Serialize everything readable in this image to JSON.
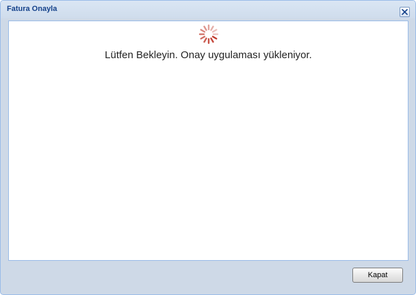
{
  "window": {
    "title": "Fatura Onayla",
    "close_icon": "close-icon",
    "accent_color": "#15428b",
    "border_color": "#99bbe8"
  },
  "content": {
    "spinner_icon": "loading-spinner-icon",
    "spinner_color": "#c0392b",
    "message": "Lütfen Bekleyin. Onay uygulaması yükleniyor."
  },
  "footer": {
    "close_label": "Kapat"
  }
}
